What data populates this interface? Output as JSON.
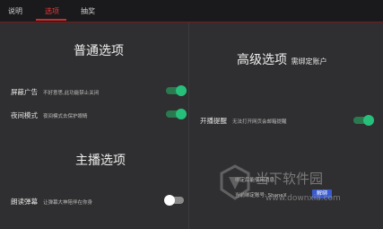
{
  "tabs": [
    {
      "label": "说明"
    },
    {
      "label": "选项"
    },
    {
      "label": "抽奖"
    }
  ],
  "active_tab": "选项",
  "general": {
    "title": "普通选项",
    "items": [
      {
        "label": "屏蔽广告",
        "desc": "不好意思,此功能禁止关闭",
        "state": "on"
      },
      {
        "label": "夜间模式",
        "desc": "夜间模式去保护眼睛",
        "state": "on"
      }
    ]
  },
  "host": {
    "title": "主播选项",
    "items": [
      {
        "label": "朗读弹幕",
        "desc": "让弹幕大神陪伴在你身",
        "state": "off"
      }
    ]
  },
  "advanced": {
    "title": "高级选项",
    "subtitle": "需绑定账户",
    "items": [
      {
        "label": "开播提醒",
        "desc": "无法打开网页会邮箱提醒",
        "state": "on"
      }
    ],
    "bind_hint": "绑定后能使用消息",
    "current_account": "当前绑定账号: ShaneX",
    "unbind_label": "解绑"
  },
  "watermark": {
    "name": "当下软件园",
    "url": "www.downxia.com"
  },
  "colors": {
    "accent_red": "#d62a2a",
    "toggle_on": "#27c07a",
    "button_blue": "#3a5bd0"
  }
}
